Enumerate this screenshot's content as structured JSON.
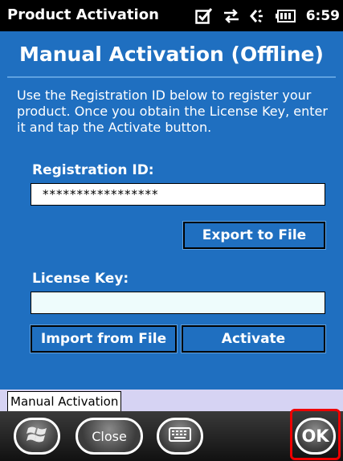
{
  "status_bar": {
    "app_title": "Product Activation",
    "time": "6:59",
    "icons": [
      "notification-check-icon",
      "data-connection-icon",
      "speaker-icon",
      "battery-icon"
    ]
  },
  "panel": {
    "heading": "Manual Activation (Offline)",
    "instructions": "Use the Registration ID below to register your product. Once you obtain the License Key, enter it and tap the Activate button.",
    "registration_label": "Registration ID:",
    "registration_value": "*****************",
    "export_button": "Export to File",
    "license_label": "License Key:",
    "license_value": "",
    "import_button": "Import from File",
    "activate_button": "Activate"
  },
  "tabs": [
    {
      "label": "Manual Activation"
    }
  ],
  "softkeys": {
    "start_icon": "windows-logo-icon",
    "close": "Close",
    "keyboard_icon": "keyboard-icon",
    "ok": "OK"
  },
  "colors": {
    "panel_bg": "#1f6fc0",
    "tab_strip_bg": "#d6d3f3",
    "highlight": "#ee0000"
  }
}
